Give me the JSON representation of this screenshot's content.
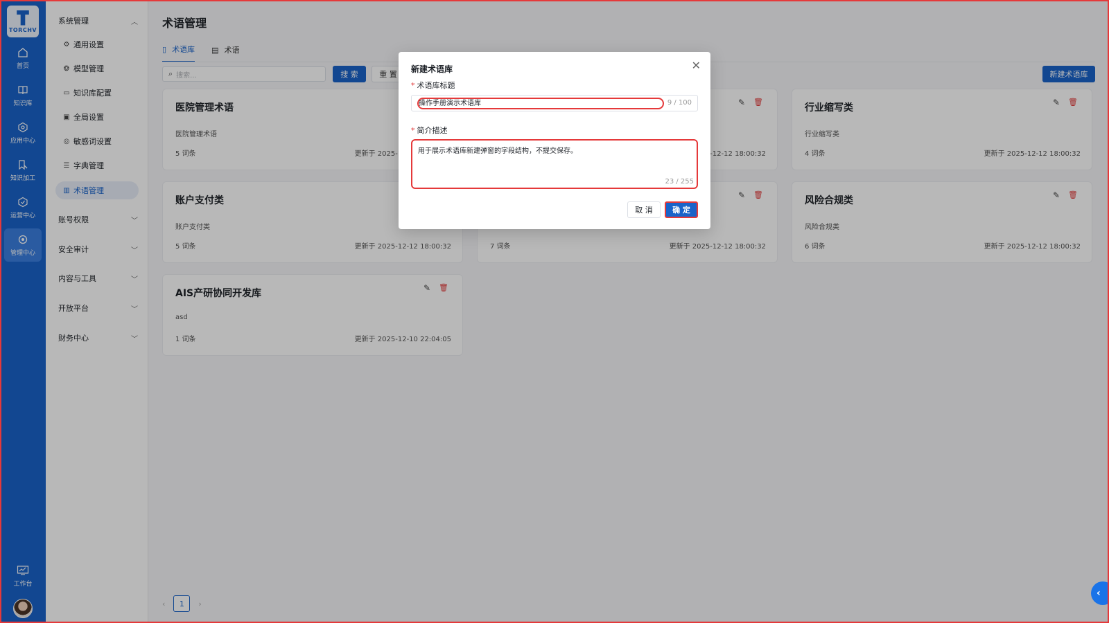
{
  "rail": {
    "logo_text": "TORCHV",
    "items": [
      {
        "label": "首页",
        "icon": "home-icon"
      },
      {
        "label": "知识库",
        "icon": "book-icon"
      },
      {
        "label": "应用中心",
        "icon": "app-icon"
      },
      {
        "label": "知识加工",
        "icon": "edit-icon"
      },
      {
        "label": "运营中心",
        "icon": "ops-icon"
      },
      {
        "label": "管理中心",
        "icon": "gear-icon"
      }
    ],
    "workbench": "工作台"
  },
  "sidebar": {
    "group_system": "系统管理",
    "sub_items": [
      "通用设置",
      "模型管理",
      "知识库配置",
      "全局设置",
      "敏感词设置",
      "字典管理",
      "术语管理"
    ],
    "groups": [
      "账号权限",
      "安全审计",
      "内容与工具",
      "开放平台",
      "财务中心"
    ]
  },
  "main": {
    "title": "术语管理",
    "tabs": [
      "术语库",
      "术语"
    ],
    "search_placeholder": "搜索...",
    "search_button": "搜 索",
    "reset_button": "重 置",
    "new_button": "新建术语库",
    "cards": [
      {
        "title": "医院管理术语",
        "desc": "医院管理术语",
        "count": "5 词条",
        "date": "更新于 2025-12-12 18:00:32"
      },
      {
        "title": "",
        "desc": "",
        "count": "",
        "date": "更新于 2025-12-12 18:00:32"
      },
      {
        "title": "行业缩写类",
        "desc": "行业缩写类",
        "count": "4 词条",
        "date": "更新于 2025-12-12 18:00:32"
      },
      {
        "title": "账户支付类",
        "desc": "账户支付类",
        "count": "5 词条",
        "date": "更新于 2025-12-12 18:00:32"
      },
      {
        "title": "",
        "desc": "",
        "count": "7 词条",
        "date": "更新于 2025-12-12 18:00:32"
      },
      {
        "title": "风险合规类",
        "desc": "风险合规类",
        "count": "6 词条",
        "date": "更新于 2025-12-12 18:00:32"
      },
      {
        "title": "AIS产研协同开发库",
        "desc": "asd",
        "count": "1 词条",
        "date": "更新于 2025-12-10 22:04:05"
      }
    ],
    "page": "1"
  },
  "modal": {
    "title": "新建术语库",
    "title_label": "术语库标题",
    "title_value": "操作手册演示术语库",
    "title_count": "9 / 100",
    "desc_label": "简介描述",
    "desc_value": "用于展示术语库新建弹窗的字段结构，不提交保存。",
    "desc_count": "23 / 255",
    "cancel": "取 消",
    "confirm": "确 定"
  },
  "colors": {
    "primary": "#1a63c9",
    "danger": "#e23b3b",
    "highlight": "#e5393a"
  }
}
